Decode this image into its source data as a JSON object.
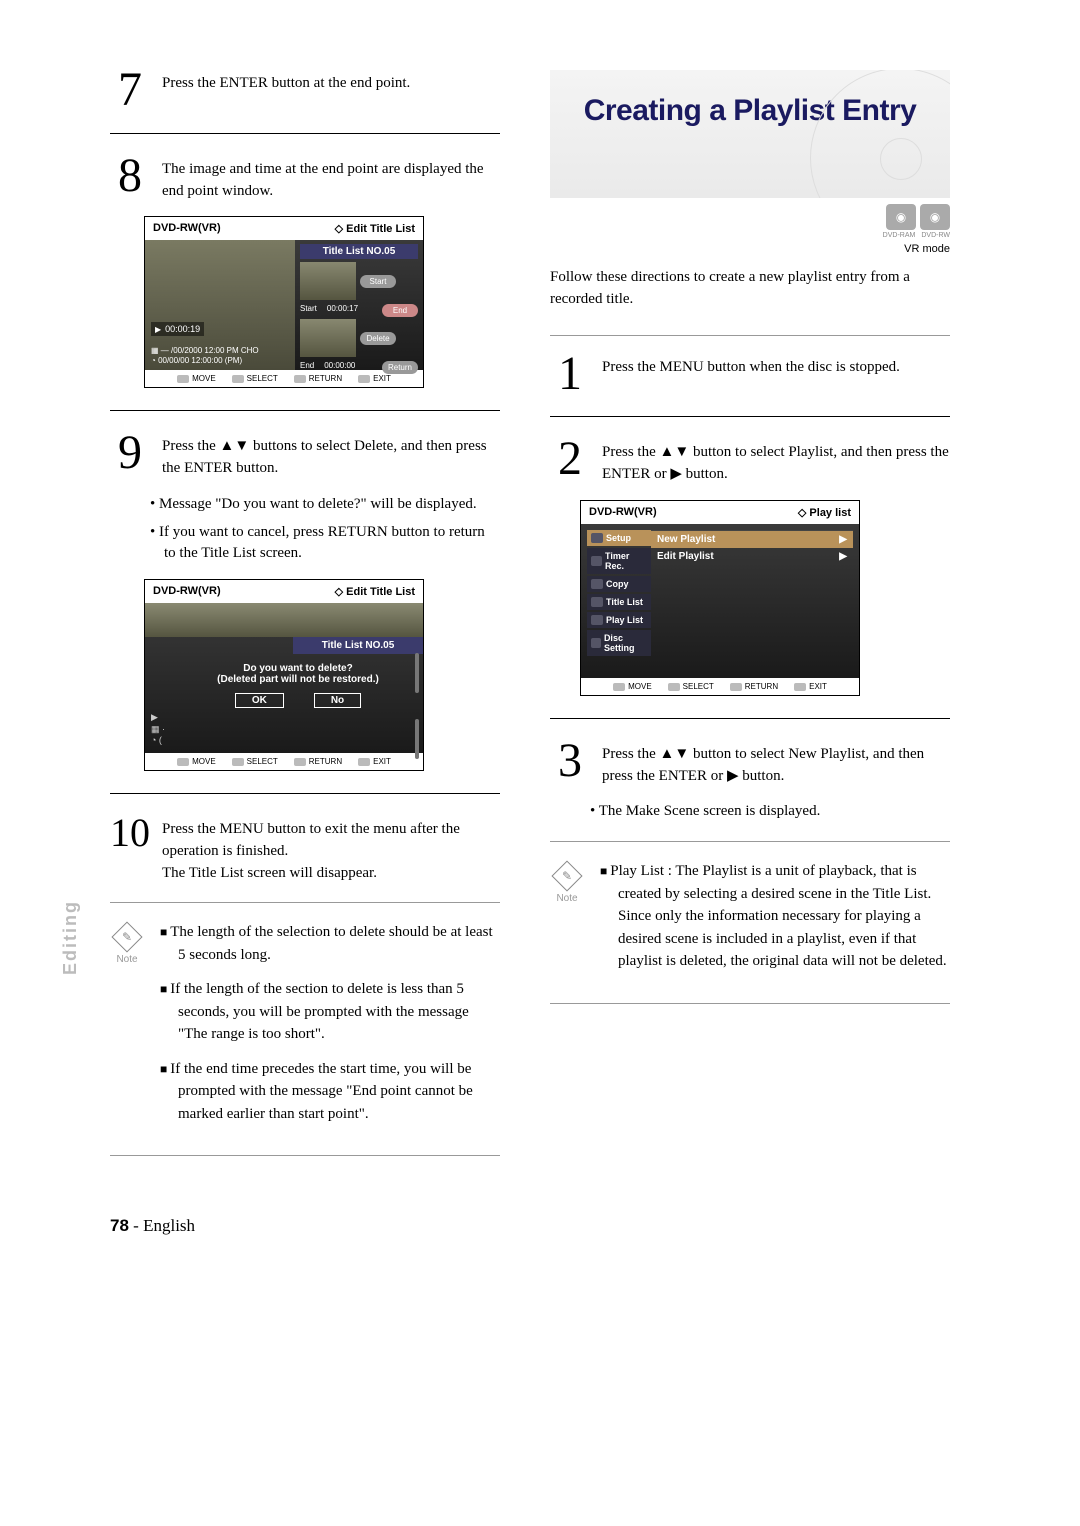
{
  "sideTab": "Editing",
  "left": {
    "step7": {
      "num": "7",
      "text": "Press the ENTER button at the end point."
    },
    "step8": {
      "num": "8",
      "text": "The image and time at the end point are displayed the end point window.",
      "shot": {
        "hdrL": "DVD-RW(VR)",
        "hdrR": "Edit Title List",
        "hdrIcon": "◇",
        "titleList": "Title List NO.05",
        "playTime": "00:00:19",
        "meta1": "— /00/2000 12:00 PM CHO",
        "meta2": "00/00/00 12:00:00 (PM)",
        "startLbl": "Start",
        "startVal": "00:00:17",
        "endLbl": "End",
        "endVal": "00:00:00",
        "btnStart": "Start",
        "btnEnd": "End",
        "btnDelete": "Delete",
        "btnReturn": "Return",
        "ftr": {
          "move": "MOVE",
          "select": "SELECT",
          "return": "RETURN",
          "exit": "EXIT"
        }
      }
    },
    "step9": {
      "num": "9",
      "text": "Press the ▲▼ buttons to select Delete, and then press the ENTER button.",
      "bul1": "Message \"Do you want to delete?\" will be displayed.",
      "bul2": "If you want to cancel, press RETURN button to return to the Title List screen.",
      "shot": {
        "hdrL": "DVD-RW(VR)",
        "hdrR": "Edit Title List",
        "hdrIcon": "◇",
        "titleList": "Title List NO.05",
        "q1": "Do you want to delete?",
        "q2": "(Deleted part will not be restored.)",
        "ok": "OK",
        "no": "No",
        "ftr": {
          "move": "MOVE",
          "select": "SELECT",
          "return": "RETURN",
          "exit": "EXIT"
        }
      }
    },
    "step10": {
      "num": "10",
      "text1": "Press the MENU button to exit the menu after the operation is finished.",
      "text2": "The Title List screen will disappear."
    },
    "notes": [
      "The length of the selection to delete should be at least 5 seconds long.",
      "If the length of the section to delete is less than 5 seconds, you will be prompted with the message \"The range is too short\".",
      "If the end time precedes the start time, you will be prompted with the message \"End point cannot be marked earlier than start point\"."
    ],
    "noteLabel": "Note"
  },
  "right": {
    "heroTitle": "Creating a Playlist Entry",
    "badgeLbl1": "DVD-RAM",
    "badgeLbl2": "DVD-RW",
    "vrMode": "VR mode",
    "intro": "Follow these directions to create a new playlist entry from a recorded title.",
    "step1": {
      "num": "1",
      "text": "Press the MENU button when the disc is stopped."
    },
    "step2": {
      "num": "2",
      "text": "Press the ▲▼ button to select Playlist, and then press the ENTER or ▶ button.",
      "shot": {
        "hdrL": "DVD-RW(VR)",
        "hdrR": "Play list",
        "hdrIcon": "◇",
        "menu": [
          "Setup",
          "Timer Rec.",
          "Copy",
          "Title List",
          "Play List",
          "Disc Setting"
        ],
        "menuHlIndex": 0,
        "sub": [
          {
            "label": "New Playlist",
            "hl": true
          },
          {
            "label": "Edit Playlist",
            "hl": false
          }
        ],
        "arrow": "▶",
        "ftr": {
          "move": "MOVE",
          "select": "SELECT",
          "return": "RETURN",
          "exit": "EXIT"
        }
      }
    },
    "step3": {
      "num": "3",
      "text": "Press the ▲▼ button to select New Playlist, and then press the ENTER or ▶ button.",
      "bul1": "The Make Scene screen is displayed."
    },
    "note": "Play List : The Playlist is a unit of playback, that is created by selecting a desired scene in the Title List. Since only the information necessary for playing a desired scene is included in a playlist, even if that playlist is deleted, the original data will not be deleted.",
    "noteLabel": "Note"
  },
  "pageNum": "78",
  "pageLang": "English"
}
